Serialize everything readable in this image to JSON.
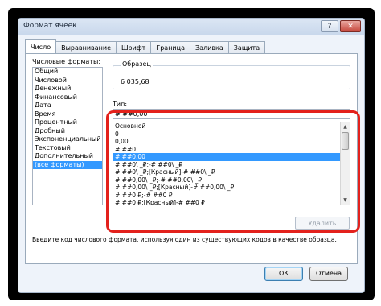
{
  "window": {
    "title": "Формат ячеек",
    "help_icon": "?",
    "close_icon": "✕"
  },
  "tabs": [
    {
      "label": "Число",
      "active": true
    },
    {
      "label": "Выравнивание"
    },
    {
      "label": "Шрифт"
    },
    {
      "label": "Граница"
    },
    {
      "label": "Заливка"
    },
    {
      "label": "Защита"
    }
  ],
  "categories": {
    "label": "Числовые форматы:",
    "items": [
      "Общий",
      "Числовой",
      "Денежный",
      "Финансовый",
      "Дата",
      "Время",
      "Процентный",
      "Дробный",
      "Экспоненциальный",
      "Текстовый",
      "Дополнительный",
      "(все форматы)"
    ],
    "selected": "(все форматы)"
  },
  "sample": {
    "label": "Образец",
    "value": "6 035,68"
  },
  "type": {
    "label": "Тип:",
    "value": "# ##0,00",
    "formats": [
      "Основной",
      "0",
      "0,00",
      "# ##0",
      "# ##0,00",
      "# ##0\\ _₽;-# ##0\\ _₽",
      "# ##0\\ _₽;[Красный]-# ##0\\ _₽",
      "# ##0,00\\ _₽;-# ##0,00\\ _₽",
      "# ##0,00\\ _₽;[Красный]-# ##0,00\\ _₽",
      "# ##0 ₽;-# ##0 ₽",
      "# ##0 ₽;[Красный]-# ##0 ₽"
    ],
    "selected": "# ##0,00"
  },
  "delete_label": "Удалить",
  "hint": "Введите код числового формата, используя один из существующих кодов в качестве образца.",
  "buttons": {
    "ok": "ОК",
    "cancel": "Отмена"
  },
  "colors": {
    "highlight": "#e3211c",
    "selection": "#3399ff"
  }
}
